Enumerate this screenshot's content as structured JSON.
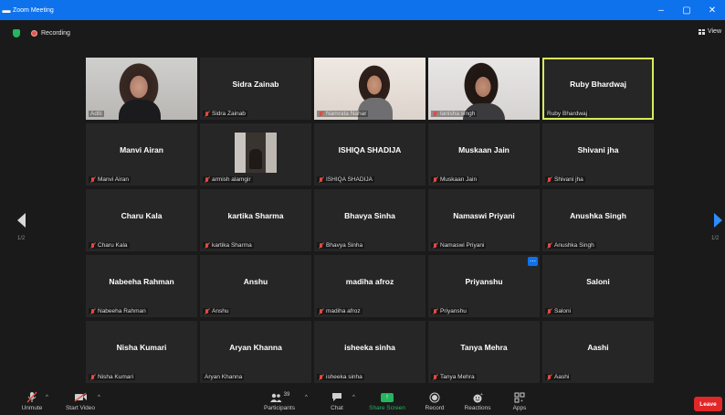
{
  "window": {
    "title": "Zoom Meeting",
    "minimize": "–",
    "maximize": "▢",
    "close": "✕"
  },
  "infobar": {
    "recording_label": "Recording",
    "view_label": "View"
  },
  "pagination": {
    "left": "1/2",
    "right": "1/2"
  },
  "tiles": [
    {
      "display": "",
      "label": "Aditi",
      "muted": false,
      "video": "aditi"
    },
    {
      "display": "Sidra Zainab",
      "label": "Sidra Zainab",
      "muted": true
    },
    {
      "display": "",
      "label": "Namrata Nahar",
      "muted": true,
      "video": "namrata"
    },
    {
      "display": "",
      "label": "tanisha singh",
      "muted": true,
      "video": "tanisha"
    },
    {
      "display": "Ruby Bhardwaj",
      "label": "Ruby Bhardwaj",
      "muted": false,
      "active": true
    },
    {
      "display": "Manvi Airan",
      "label": "Manvi Airan",
      "muted": true
    },
    {
      "display": "",
      "label": "armish alamgir",
      "muted": true,
      "video": "armish"
    },
    {
      "display": "ISHIQA SHADIJA",
      "label": "ISHIQA SHADIJA",
      "muted": true
    },
    {
      "display": "Muskaan Jain",
      "label": "Muskaan Jain",
      "muted": true
    },
    {
      "display": "Shivani jha",
      "label": "Shivani jha",
      "muted": true
    },
    {
      "display": "Charu Kala",
      "label": "Charu Kala",
      "muted": true
    },
    {
      "display": "kartika Sharma",
      "label": "kartika Sharma",
      "muted": true
    },
    {
      "display": "Bhavya Sinha",
      "label": "Bhavya Sinha",
      "muted": true
    },
    {
      "display": "Namaswi Priyani",
      "label": "Namaswi Priyani",
      "muted": true
    },
    {
      "display": "Anushka Singh",
      "label": "Anushka Singh",
      "muted": true
    },
    {
      "display": "Nabeeha Rahman",
      "label": "Nabeeha Rahman",
      "muted": true
    },
    {
      "display": "Anshu",
      "label": "Anshu",
      "muted": true
    },
    {
      "display": "madiha afroz",
      "label": "madiha afroz",
      "muted": true
    },
    {
      "display": "Priyanshu",
      "label": "Priyanshu",
      "muted": true,
      "more": true
    },
    {
      "display": "Saloni",
      "label": "Saloni",
      "muted": true
    },
    {
      "display": "Nisha Kumari",
      "label": "Nisha Kumari",
      "muted": true
    },
    {
      "display": "Aryan Khanna",
      "label": "Aryan Khanna",
      "muted": false
    },
    {
      "display": "isheeka sinha",
      "label": "isheeka sinha",
      "muted": true
    },
    {
      "display": "Tanya Mehra",
      "label": "Tanya Mehra",
      "muted": true
    },
    {
      "display": "Aashi",
      "label": "Aashi",
      "muted": true
    }
  ],
  "toolbar": {
    "unmute": "Unmute",
    "start_video": "Start Video",
    "participants": "Participants",
    "participant_count": "39",
    "chat": "Chat",
    "share_screen": "Share Screen",
    "record": "Record",
    "reactions": "Reactions",
    "apps": "Apps",
    "leave": "Leave"
  },
  "colors": {
    "accent": "#0e72ed",
    "share": "#23b55f",
    "leave": "#e02828",
    "active_speaker": "#d9ec5a",
    "muted_mic": "#e24a43"
  }
}
